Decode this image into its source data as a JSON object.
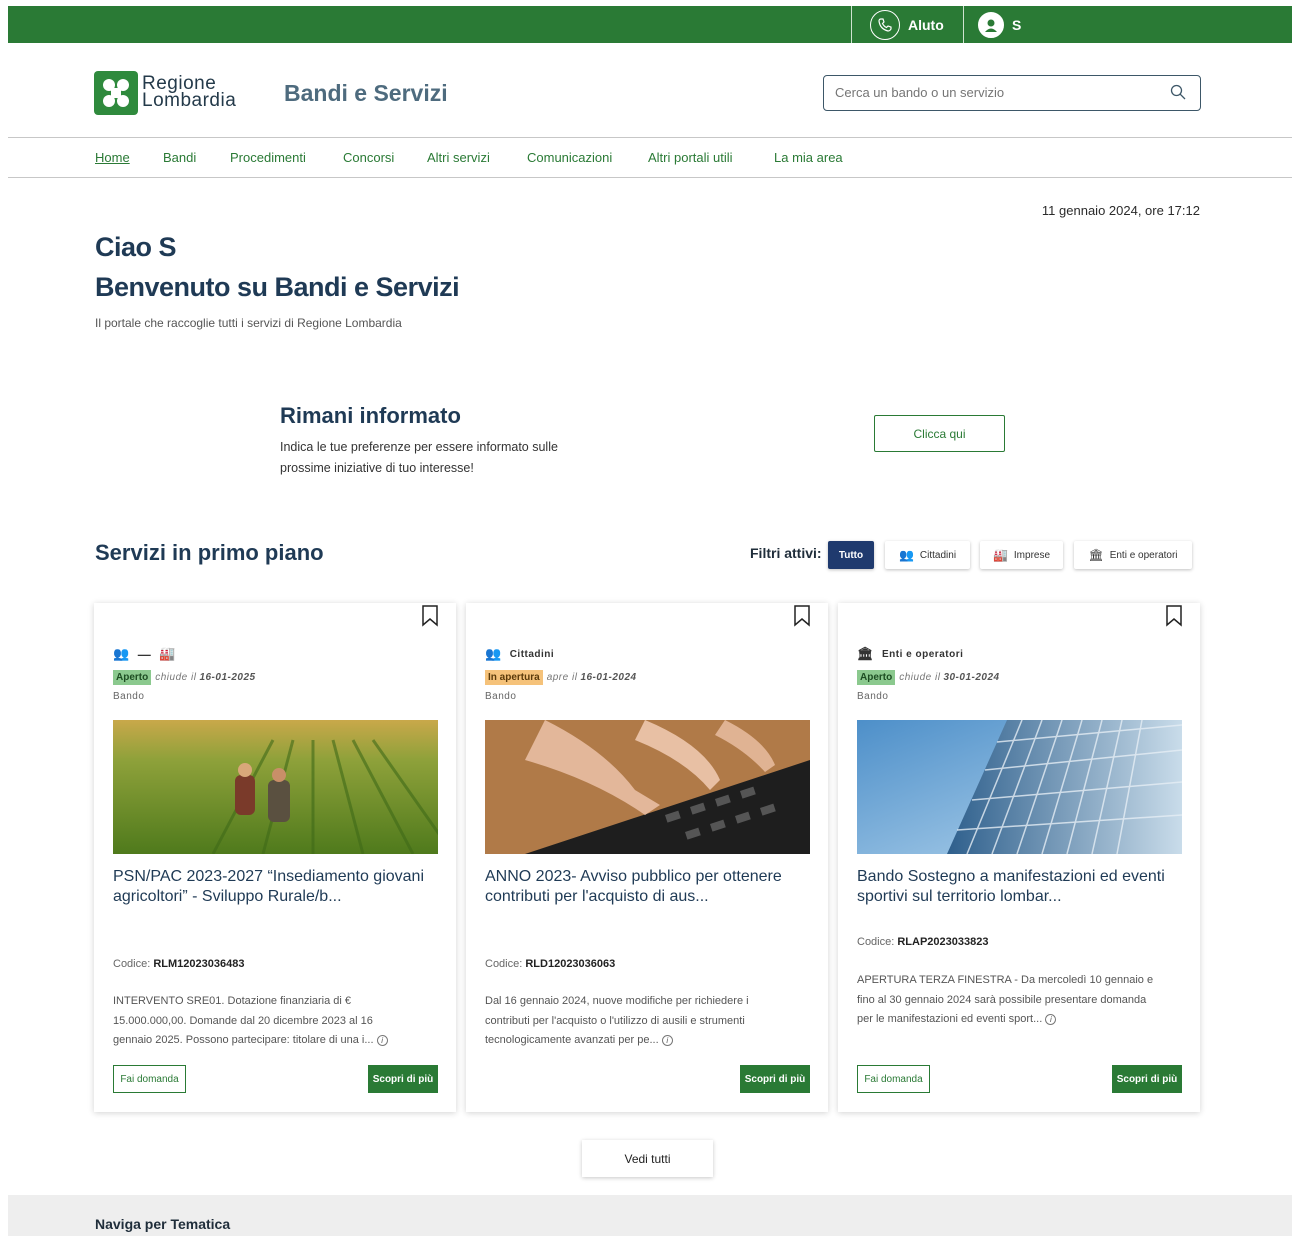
{
  "topbar": {
    "help_label": "Aluto",
    "user_initial": "S"
  },
  "header": {
    "logo_line1": "Regione",
    "logo_line2": "Lombardia",
    "site_title": "Bandi e Servizi",
    "search_placeholder": "Cerca un bando o un servizio"
  },
  "nav": [
    "Home",
    "Bandi",
    "Procedimenti",
    "Concorsi",
    "Altri servizi",
    "Comunicazioni",
    "Altri portali utili",
    "La mia area"
  ],
  "date": "11 gennaio 2024, ore 17:12",
  "greeting": "Ciao S",
  "welcome": "Benvenuto su Bandi e Servizi",
  "subtitle": "Il portale che raccoglie tutti i servizi di Regione Lombardia",
  "info": {
    "title": "Rimani informato",
    "text": "Indica le tue preferenze per essere informato sulle prossime iniziative di tuo interesse!",
    "button": "Clicca qui"
  },
  "section": {
    "title": "Servizi in primo piano",
    "filters_label": "Filtri attivi:",
    "filters": [
      "Tutto",
      "Cittadini",
      "Imprese",
      "Enti e operatori"
    ]
  },
  "cards": [
    {
      "audience": "",
      "status": "Aperto",
      "date_label": "chiude il",
      "date": "16-01-2025",
      "type": "Bando",
      "title": "PSN/PAC 2023-2027 “Insediamento giovani agricoltori” - Sviluppo Rurale/b...",
      "code_label": "Codice:",
      "code": "RLM12023036483",
      "description": "INTERVENTO SRE01. Dotazione finanziaria di € 15.000.000,00. Domande dal 20 dicembre 2023 al 16 gennaio 2025. Possono partecipare: titolare di una i...",
      "btn_apply": "Fai domanda",
      "btn_more": "Scopri di più"
    },
    {
      "audience": "Cittadini",
      "status": "In apertura",
      "date_label": "apre il",
      "date": "16-01-2024",
      "type": "Bando",
      "title": "ANNO 2023- Avviso pubblico per ottenere contributi per l'acquisto di aus...",
      "code_label": "Codice:",
      "code": "RLD12023036063",
      "description": "Dal 16 gennaio 2024, nuove modifiche per richiedere i contributi per l'acquisto o l'utilizzo di ausili e strumenti tecnologicamente avanzati per pe...",
      "btn_more": "Scopri di più"
    },
    {
      "audience": "Enti e operatori",
      "status": "Aperto",
      "date_label": "chiude il",
      "date": "30-01-2024",
      "type": "Bando",
      "title": "Bando Sostegno a manifestazioni ed eventi sportivi sul territorio lombar...",
      "code_label": "Codice:",
      "code": "RLAP2023033823",
      "description": "APERTURA TERZA FINESTRA - Da mercoledì 10 gennaio e fino al 30 gennaio 2024 sarà possibile presentare domanda per le manifestazioni ed eventi sport...",
      "btn_apply": "Fai domanda",
      "btn_more": "Scopri di più"
    }
  ],
  "see_all": "Vedi tutti",
  "footer": {
    "title": "Naviga per Tematica"
  },
  "colors": {
    "brand_green": "#2a7a35",
    "title_blue": "#1f3a55",
    "filter_active": "#1f3a6e"
  }
}
